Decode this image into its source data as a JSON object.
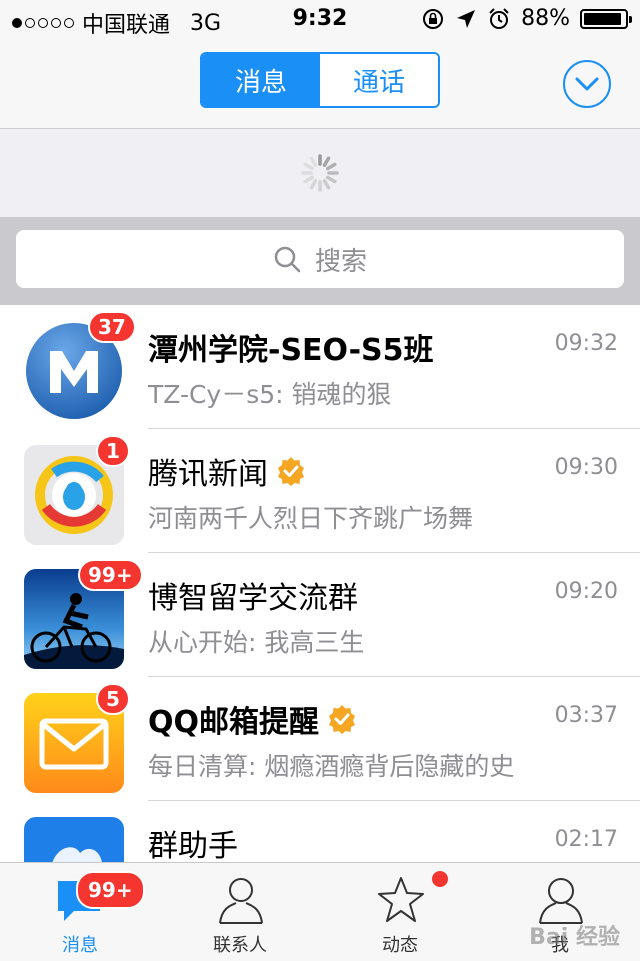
{
  "status_bar": {
    "carrier": "中国联通",
    "network": "3G",
    "time": "9:32",
    "battery": "88%"
  },
  "nav": {
    "segments": [
      "消息",
      "通话"
    ],
    "active_segment": "消息"
  },
  "search": {
    "placeholder": "搜索"
  },
  "conversations": [
    {
      "title": "潭州学院-SEO-S5班",
      "time": "09:32",
      "preview": "TZ-Cy－s5: 销魂的狠",
      "badge": "37",
      "avatar": "m-logo-icon",
      "verified": false
    },
    {
      "title": "腾讯新闻",
      "time": "09:30",
      "preview": "河南两千人烈日下齐跳广场舞",
      "badge": "1",
      "avatar": "tencent-news-icon",
      "verified": true
    },
    {
      "title": "博智留学交流群",
      "time": "09:20",
      "preview": "从心开始: 我高三生",
      "badge": "99+",
      "avatar": "cyclist-photo",
      "verified": false
    },
    {
      "title": "QQ邮箱提醒",
      "time": "03:37",
      "preview": "每日清算: 烟瘾酒瘾背后隐藏的史",
      "badge": "5",
      "avatar": "mail-icon",
      "verified": true
    },
    {
      "title": "群助手",
      "time": "02:17",
      "preview": "",
      "badge": "",
      "avatar": "group-helper-icon",
      "verified": false
    }
  ],
  "tabbar": {
    "tabs": [
      {
        "label": "消息",
        "icon": "message-bubble-icon",
        "active": true,
        "badge": "99+"
      },
      {
        "label": "联系人",
        "icon": "person-icon",
        "active": false
      },
      {
        "label": "动态",
        "icon": "star-icon",
        "active": false,
        "dot": true
      },
      {
        "label": "我",
        "icon": "profile-icon",
        "active": false
      }
    ]
  },
  "watermark": "Bai 经验",
  "colors": {
    "accent": "#1a8ff6",
    "badge": "#f43530",
    "verified": "#f5a623"
  }
}
